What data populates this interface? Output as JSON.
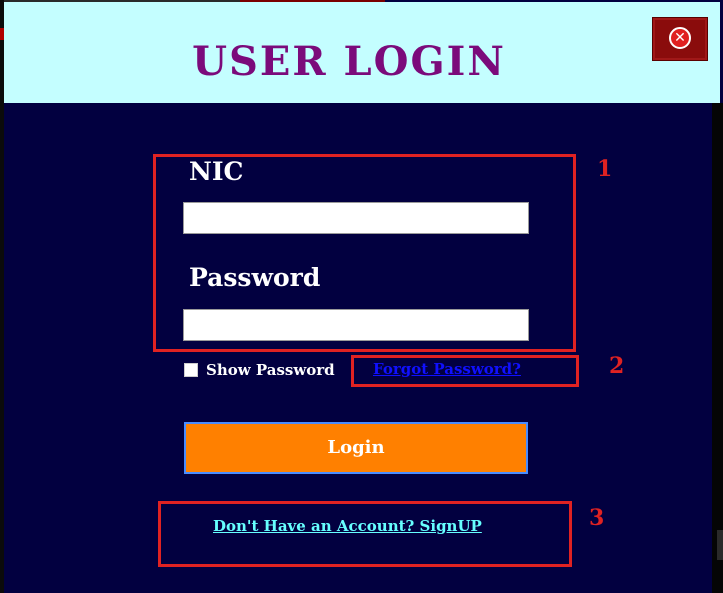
{
  "window": {
    "title": "USER LOGIN",
    "close_icon": "close-icon",
    "colors": {
      "header_bg": "#c4feff",
      "title": "#7b0a7b",
      "body_bg": "#020040",
      "login_button": "#ff8000",
      "annotation": "#e02222",
      "forgot_link": "#1010ff",
      "signup_link": "#66ffff"
    }
  },
  "form": {
    "nic_label": "NIC",
    "nic_value": "",
    "password_label": "Password",
    "password_value": "",
    "show_password_label": "Show Password",
    "show_password_checked": false,
    "forgot_link": "Forgot Password?",
    "login_button": "Login",
    "signup_link": "Don't Have an Account? SignUP"
  },
  "annotations": {
    "marker_1": "1",
    "marker_2": "2",
    "marker_3": "3"
  }
}
